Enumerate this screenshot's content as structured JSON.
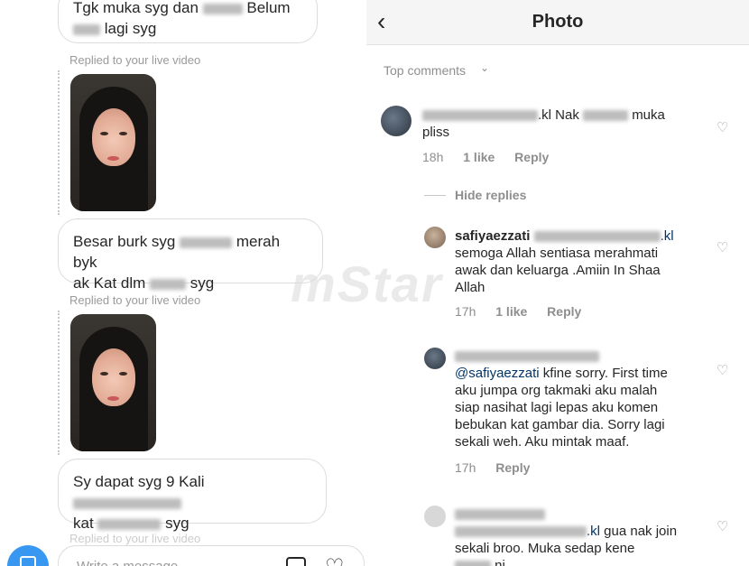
{
  "left": {
    "bubble1": {
      "line1_start": "Tgk muka syg dan",
      "line1_end": "Belum",
      "line2_end": "lagi syg"
    },
    "reply_note_1": "Replied to your live video",
    "bubble2": {
      "line1": "Besar burk syg",
      "line1_end": "merah byk",
      "line2_start": "ak Kat dlm",
      "line2_end": "syg"
    },
    "reply_note_2": "Replied to your live video",
    "bubble3": {
      "line1_start": "Sy dapat syg 9 Kali",
      "line2_start": "kat",
      "line2_end": "syg"
    },
    "reply_note_3": "Replied to your live video",
    "composer_placeholder": "Write a message..."
  },
  "right": {
    "header": {
      "title": "Photo"
    },
    "top_comments_label": "Top comments",
    "comment1": {
      "username_suffix": ".kl Nak",
      "text_end": "muka",
      "text_line2": "pliss",
      "time": "18h",
      "likes": "1 like",
      "reply": "Reply"
    },
    "hide_replies": "Hide replies",
    "comment2": {
      "username": "safiyaezzati",
      "mention_suffix": ".kl",
      "line2": "semoga Allah sentiasa merahmati",
      "line3": "awak dan keluarga .Amiin In Shaa",
      "line4": "Allah",
      "time": "17h",
      "likes": "1 like",
      "reply": "Reply"
    },
    "comment3": {
      "mention": "@safiyaezzati",
      "line1_rest": "kfine sorry. First time",
      "line2": "aku jumpa org takmaki aku malah",
      "line3": "siap nasihat lagi lepas aku komen",
      "line4": "bebukan kat gambar dia. Sorry lagi",
      "line5": "sekali weh. Aku mintak maaf.",
      "time": "17h",
      "reply": "Reply"
    },
    "comment4": {
      "mention_suffix": ".kl",
      "line1_rest": "gua nak join",
      "line2": "sekali broo. Muka sedap kene",
      "line3": "ni"
    }
  },
  "watermark": "mStar"
}
